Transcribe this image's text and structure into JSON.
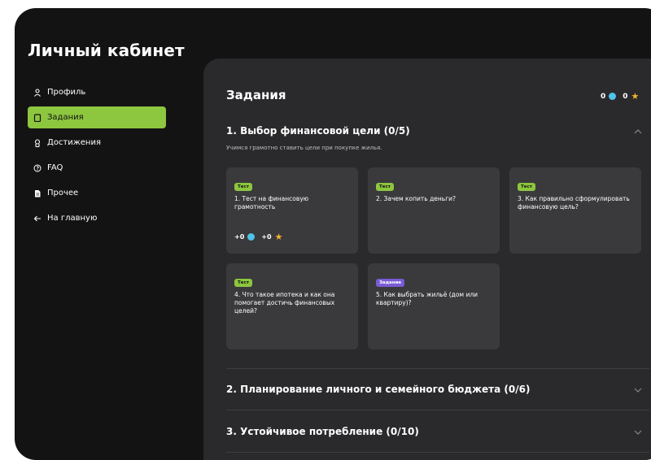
{
  "app": {
    "title": "Личный кабинет"
  },
  "sidebar": {
    "items": [
      {
        "label": "Профиль",
        "icon": "user-icon"
      },
      {
        "label": "Задания",
        "icon": "clipboard-icon",
        "active": true
      },
      {
        "label": "Достижения",
        "icon": "medal-icon"
      },
      {
        "label": "FAQ",
        "icon": "question-icon"
      },
      {
        "label": "Прочее",
        "icon": "document-icon"
      },
      {
        "label": "На главную",
        "icon": "arrow-left-icon"
      }
    ]
  },
  "header": {
    "title": "Задания",
    "gems": "0",
    "stars": "0"
  },
  "sections": [
    {
      "title": "1. Выбор финансовой цели (0/5)",
      "subtitle": "Учимся грамотно ставить цели при покупке жилья.",
      "expanded": true,
      "cards": [
        {
          "badge": "Тест",
          "text": "1. Тест на финансовую грамотность",
          "reward_gems": "+0",
          "reward_stars": "+0"
        },
        {
          "badge": "Тест",
          "text": "2. Зачем копить деньги?"
        },
        {
          "badge": "Тест",
          "text": "3. Как правильно сформулировать финансовую цель?"
        },
        {
          "badge": "Тест",
          "text": "4. Что такое ипотека и как она помогает достичь финансовых целей?"
        },
        {
          "badge": "Задание",
          "text": "5. Как выбрать жильё (дом или квартиру)?"
        }
      ]
    },
    {
      "title": "2. Планирование личного и семейного бюджета (0/6)",
      "expanded": false
    },
    {
      "title": "3. Устойчивое потребление (0/10)",
      "expanded": false
    }
  ],
  "colors": {
    "accent": "#8dc63f",
    "task_badge": "#7a5cd6",
    "gem": "#4fc3e8",
    "star": "#f5b52e"
  }
}
